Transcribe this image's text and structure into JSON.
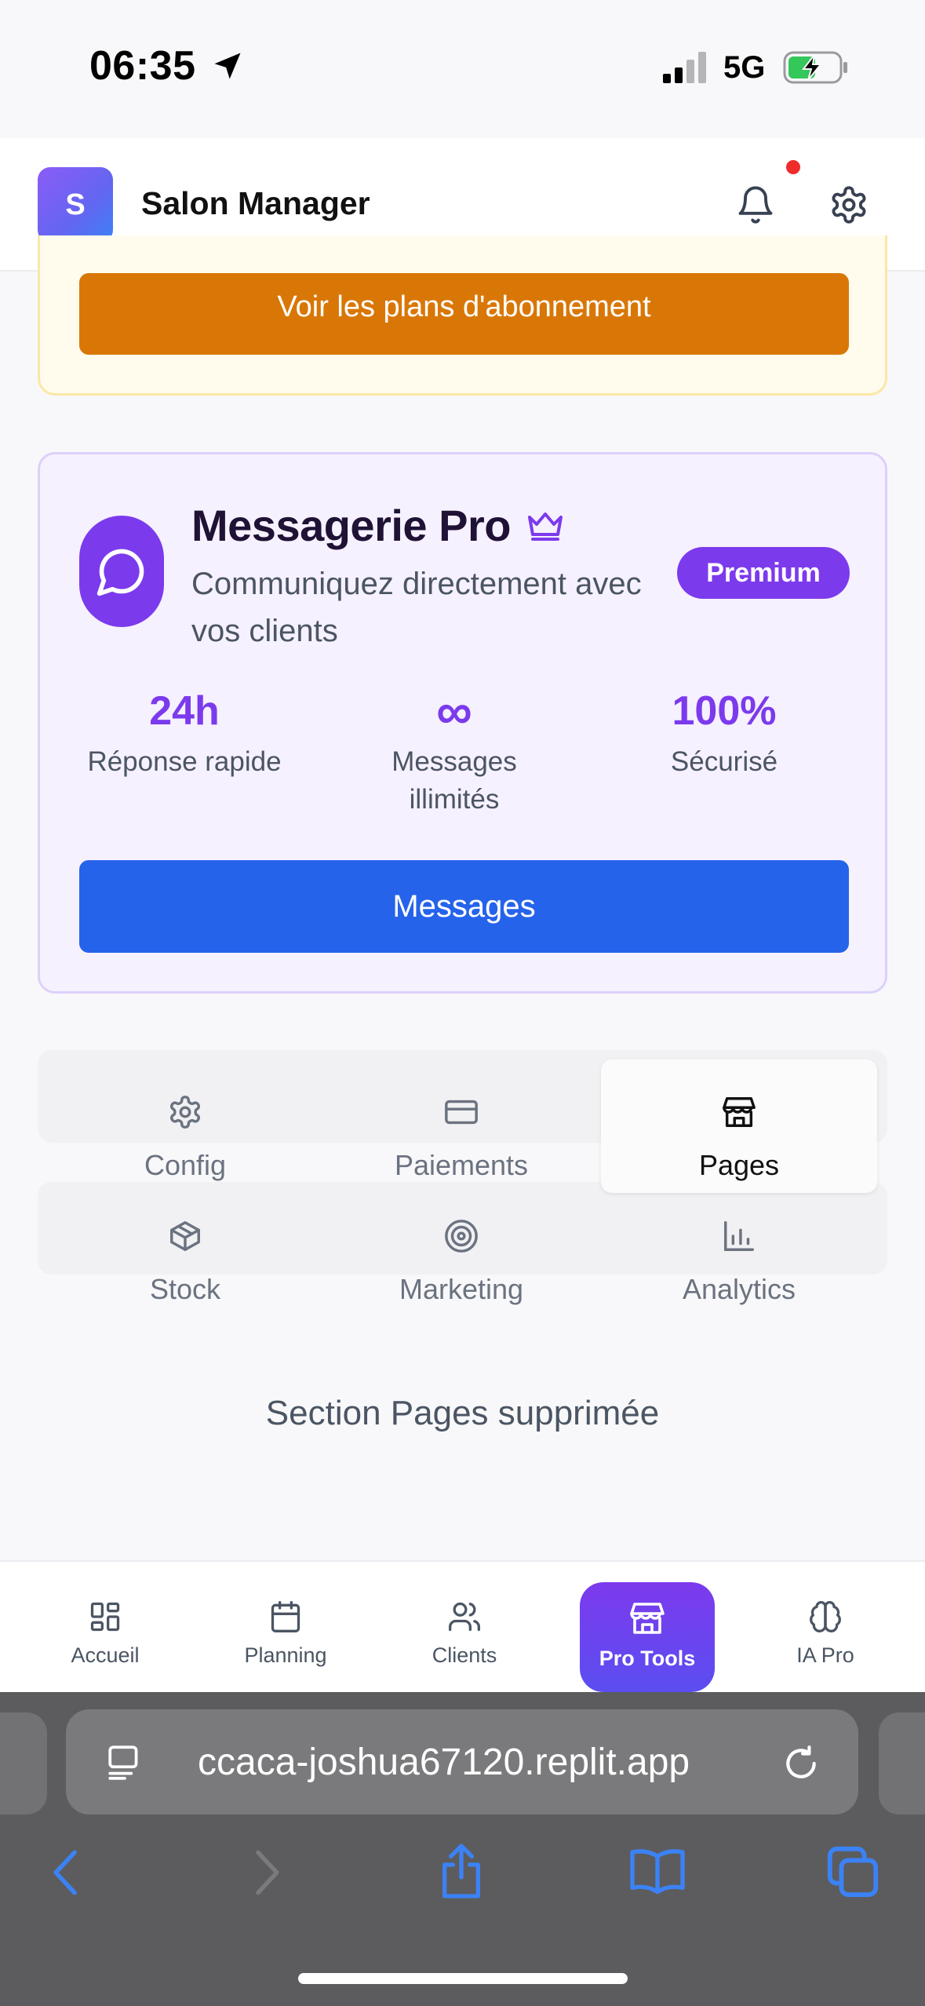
{
  "status_bar": {
    "time": "06:35",
    "network": "5G"
  },
  "header": {
    "logo_letter": "S",
    "title": "Salon Manager"
  },
  "upsell": {
    "button_label": "Voir les plans d'abonnement"
  },
  "messaging": {
    "title": "Messagerie Pro",
    "subtitle": "Communiquez directement avec vos clients",
    "badge": "Premium",
    "stats": [
      {
        "value": "24h",
        "label": "Réponse rapide"
      },
      {
        "value": "∞",
        "label": "Messages illimités"
      },
      {
        "value": "100%",
        "label": "Sécurisé"
      }
    ],
    "button_label": "Messages"
  },
  "tools_tabs": [
    {
      "label": "Config",
      "icon": "gear-icon"
    },
    {
      "label": "Paiements",
      "icon": "credit-card-icon"
    },
    {
      "label": "Pages",
      "icon": "store-icon",
      "active": true
    },
    {
      "label": "Stock",
      "icon": "box-icon"
    },
    {
      "label": "Marketing",
      "icon": "target-icon"
    },
    {
      "label": "Analytics",
      "icon": "bar-chart-icon"
    }
  ],
  "content": {
    "message": "Section Pages supprimée"
  },
  "bottom_nav": [
    {
      "label": "Accueil",
      "icon": "grid-icon"
    },
    {
      "label": "Planning",
      "icon": "calendar-icon"
    },
    {
      "label": "Clients",
      "icon": "users-icon"
    },
    {
      "label": "Pro Tools",
      "icon": "store-icon",
      "active": true
    },
    {
      "label": "IA Pro",
      "icon": "brain-icon"
    }
  ],
  "browser": {
    "url": "ccaca-joshua67120.replit.app"
  },
  "colors": {
    "accent": "#7c3aed",
    "primary_button": "#2563eb",
    "upsell_button": "#d97706",
    "notification": "#ef2b2b"
  }
}
